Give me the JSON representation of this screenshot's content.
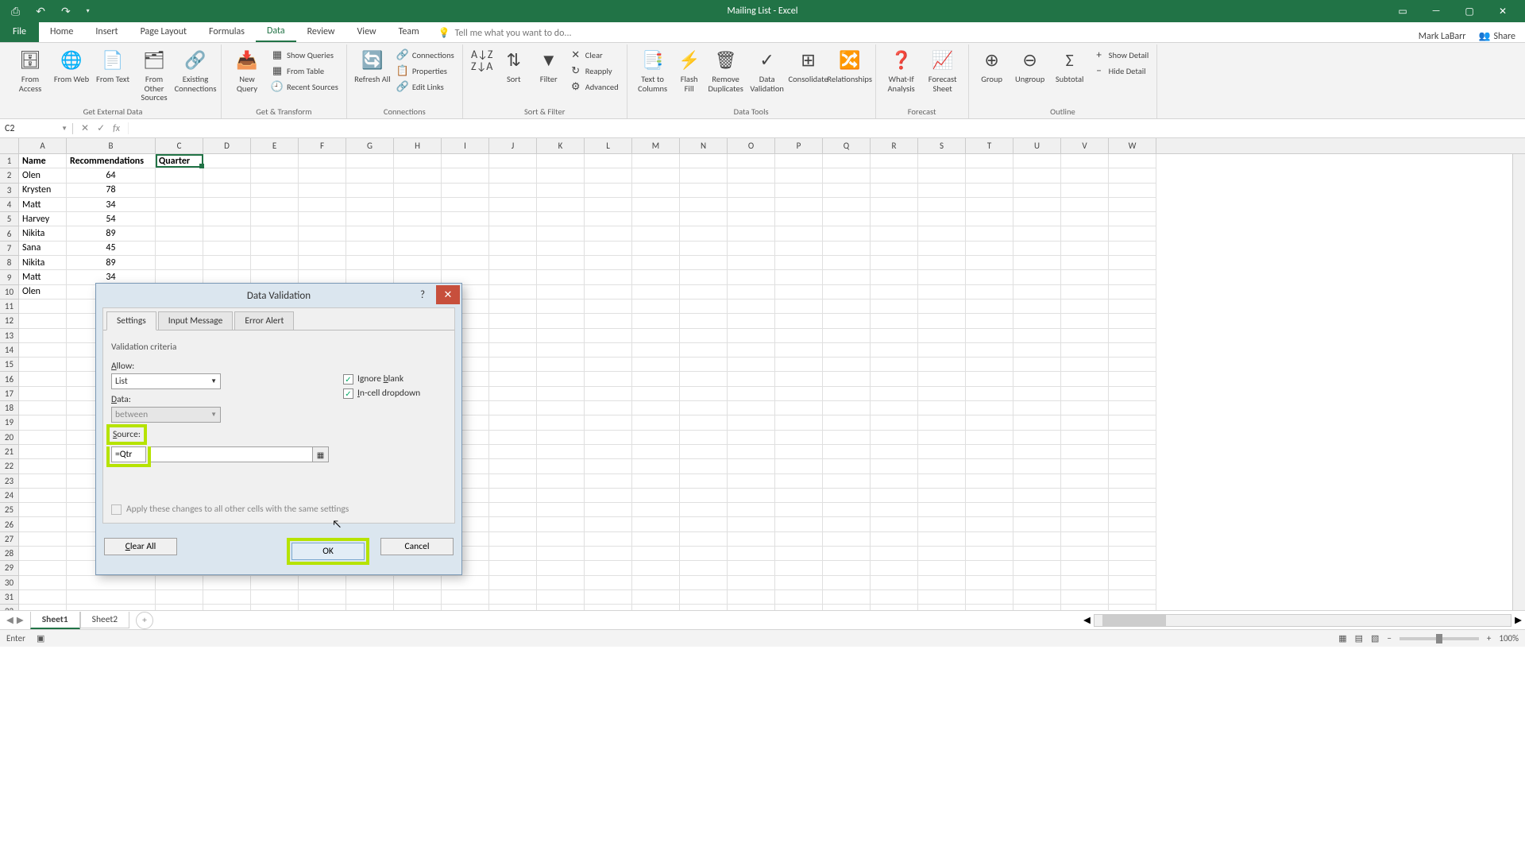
{
  "app": {
    "title": "Mailing List - Excel",
    "user": "Mark LaBarr",
    "share": "Share"
  },
  "qat": {
    "save": "💾",
    "undo": "↶",
    "redo": "↷"
  },
  "tabs": {
    "file": "File",
    "items": [
      "Home",
      "Insert",
      "Page Layout",
      "Formulas",
      "Data",
      "Review",
      "View",
      "Team"
    ],
    "active": "Data",
    "tellme": "Tell me what you want to do..."
  },
  "ribbon": {
    "g1": {
      "label": "Get External Data",
      "btns": [
        "From Access",
        "From Web",
        "From Text",
        "From Other Sources",
        "Existing Connections"
      ]
    },
    "g2": {
      "label": "Get & Transform",
      "big": "New Query",
      "items": [
        "Show Queries",
        "From Table",
        "Recent Sources"
      ]
    },
    "g3": {
      "label": "Connections",
      "big": "Refresh All",
      "items": [
        "Connections",
        "Properties",
        "Edit Links"
      ]
    },
    "g4": {
      "label": "Sort & Filter",
      "sort": "Sort",
      "filter": "Filter",
      "items": [
        "Clear",
        "Reapply",
        "Advanced"
      ]
    },
    "g5": {
      "label": "Data Tools",
      "btns": [
        "Text to Columns",
        "Flash Fill",
        "Remove Duplicates",
        "Data Validation",
        "Consolidate",
        "Relationships"
      ]
    },
    "g6": {
      "label": "Forecast",
      "btns": [
        "What-If Analysis",
        "Forecast Sheet"
      ]
    },
    "g7": {
      "label": "Outline",
      "btns": [
        "Group",
        "Ungroup",
        "Subtotal"
      ],
      "items": [
        "Show Detail",
        "Hide Detail"
      ]
    }
  },
  "namebox": "C2",
  "columns": [
    "A",
    "B",
    "C",
    "D",
    "E",
    "F",
    "G",
    "H",
    "I",
    "J",
    "K",
    "L",
    "M",
    "N",
    "O",
    "P",
    "Q",
    "R",
    "S",
    "T",
    "U",
    "V",
    "W"
  ],
  "headers": {
    "a": "Name",
    "b": "Recommendations",
    "c": "Quarter"
  },
  "rows": [
    {
      "a": "Olen",
      "b": "64"
    },
    {
      "a": "Krysten",
      "b": "78"
    },
    {
      "a": "Matt",
      "b": "34"
    },
    {
      "a": "Harvey",
      "b": "54"
    },
    {
      "a": "Nikita",
      "b": "89"
    },
    {
      "a": "Sana",
      "b": "45"
    },
    {
      "a": "Nikita",
      "b": "89"
    },
    {
      "a": "Matt",
      "b": "34"
    },
    {
      "a": "Olen",
      "b": ""
    }
  ],
  "sheets": {
    "active": "Sheet1",
    "other": "Sheet2"
  },
  "status": {
    "mode": "Enter",
    "zoom": "100%"
  },
  "dialog": {
    "title": "Data Validation",
    "tabs": [
      "Settings",
      "Input Message",
      "Error Alert"
    ],
    "section": "Validation criteria",
    "allow_label": "Allow:",
    "allow_value": "List",
    "data_label": "Data:",
    "data_value": "between",
    "ignore": "Ignore blank",
    "incell": "In-cell dropdown",
    "source_label": "Source:",
    "source_value": "=Qtr",
    "apply": "Apply these changes to all other cells with the same settings",
    "clear": "Clear All",
    "ok": "OK",
    "cancel": "Cancel"
  }
}
